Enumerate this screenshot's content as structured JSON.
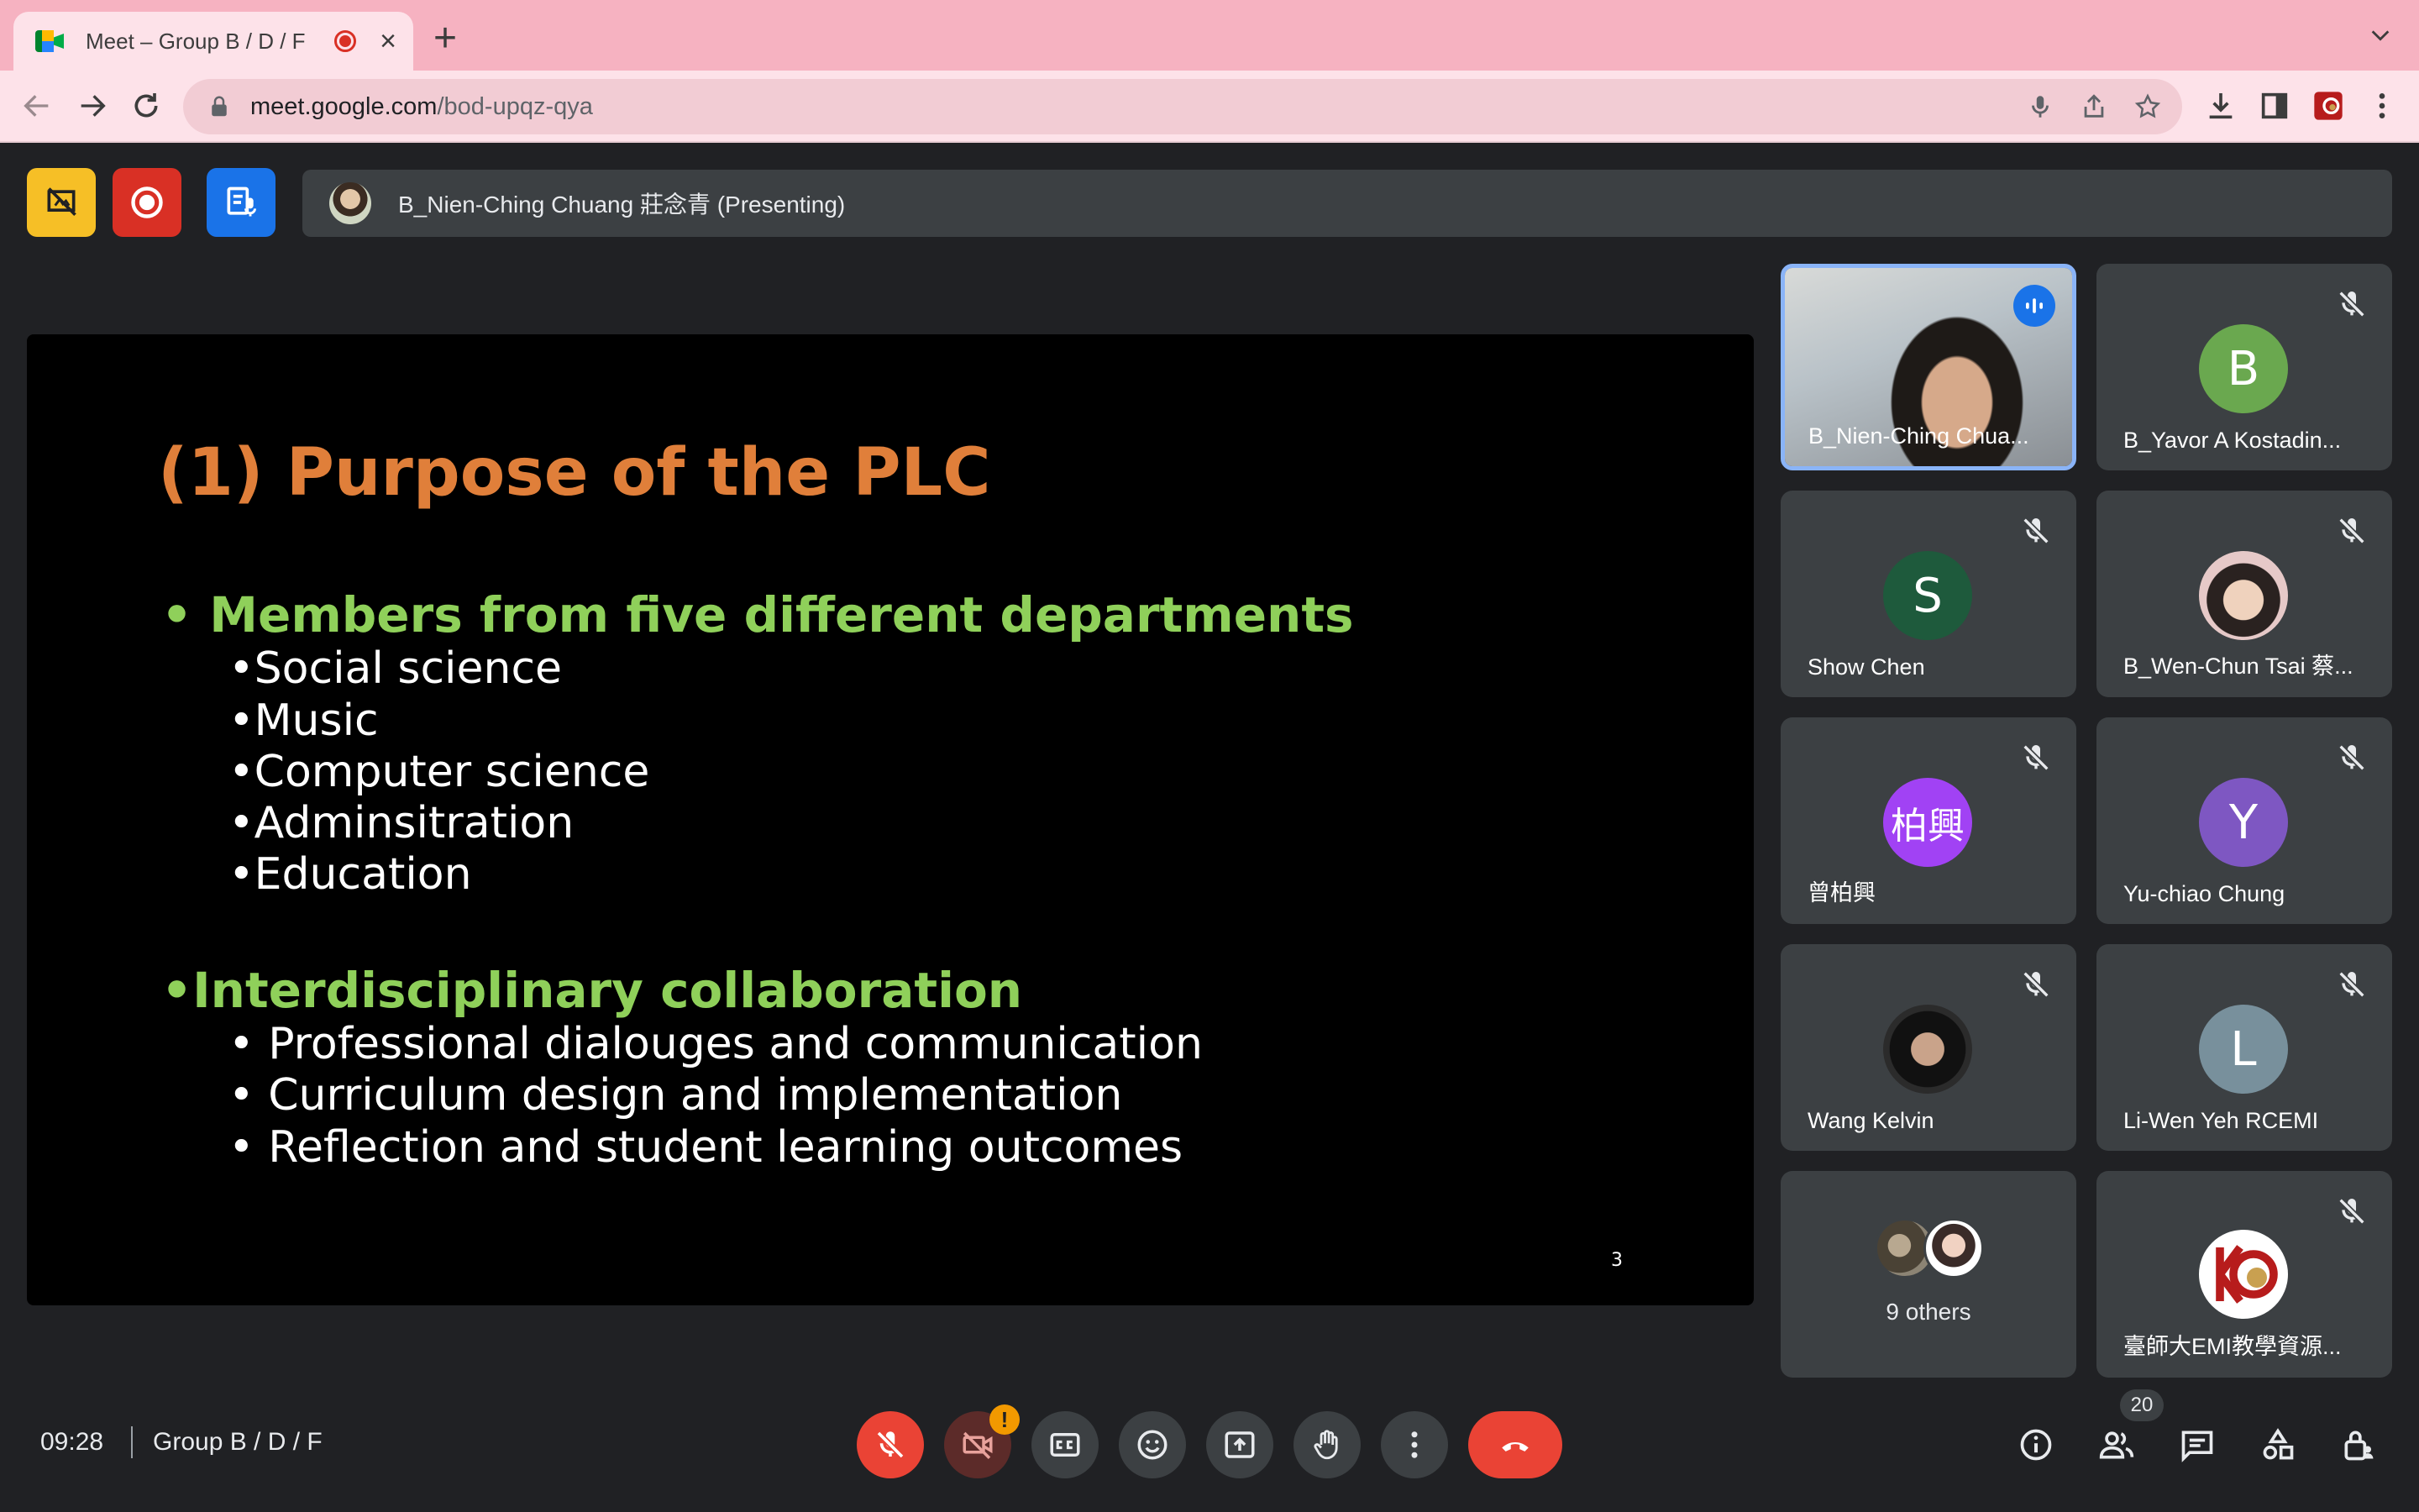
{
  "browser": {
    "tab_title": "Meet – Group B / D / F",
    "new_tab_symbol": "+",
    "close_symbol": "×",
    "url_host": "meet.google.com",
    "url_path": "/bod-upqz-qya"
  },
  "meet": {
    "presenting_text": "B_Nien-Ching Chuang 莊念青 (Presenting)",
    "slide": {
      "title": "(1) Purpose of the PLC",
      "bullet1": "• Members from five different departments",
      "sub1": [
        "•Social science",
        "•Music",
        "•Computer science",
        "•Adminsitration",
        "•Education"
      ],
      "bullet2": "•Interdisciplinary collaboration",
      "sub2": [
        "• Professional dialouges and communication",
        "• Curriculum design and implementation",
        "• Reflection and student learning outcomes"
      ],
      "page_number": "3"
    },
    "participants": [
      {
        "name": "B_Nien-Ching Chua...",
        "type": "video",
        "speaking": true
      },
      {
        "name": "B_Yavor A Kostadin...",
        "initial": "B",
        "color": "#6aa84f"
      },
      {
        "name": "Show Chen",
        "initial": "S",
        "color": "#1e5a3c"
      },
      {
        "name": "B_Wen-Chun Tsai 蔡...",
        "type": "photo"
      },
      {
        "name": "曾柏興",
        "initial": "柏興",
        "color": "#a142f4"
      },
      {
        "name": "Yu-chiao Chung",
        "initial": "Y",
        "color": "#7e57c2"
      },
      {
        "name": "Wang Kelvin",
        "type": "photo"
      },
      {
        "name": "Li-Wen Yeh RCEMI",
        "initial": "L",
        "color": "#78909c"
      },
      {
        "name": "臺師大EMI教學資源...",
        "type": "logo"
      }
    ],
    "others_label": "9 others",
    "footer": {
      "time": "09:28",
      "meeting_name": "Group B / D / F",
      "participant_count": "20",
      "warning_mark": "!"
    }
  },
  "colors": {
    "tabbar": "#f6b2c1",
    "toolbar": "#fde2e9",
    "meet_bg": "#202124",
    "tile_bg": "#3c4043",
    "end_call": "#ea4335",
    "slide_title": "#e07f3a",
    "slide_bullet": "#8fd05a"
  }
}
